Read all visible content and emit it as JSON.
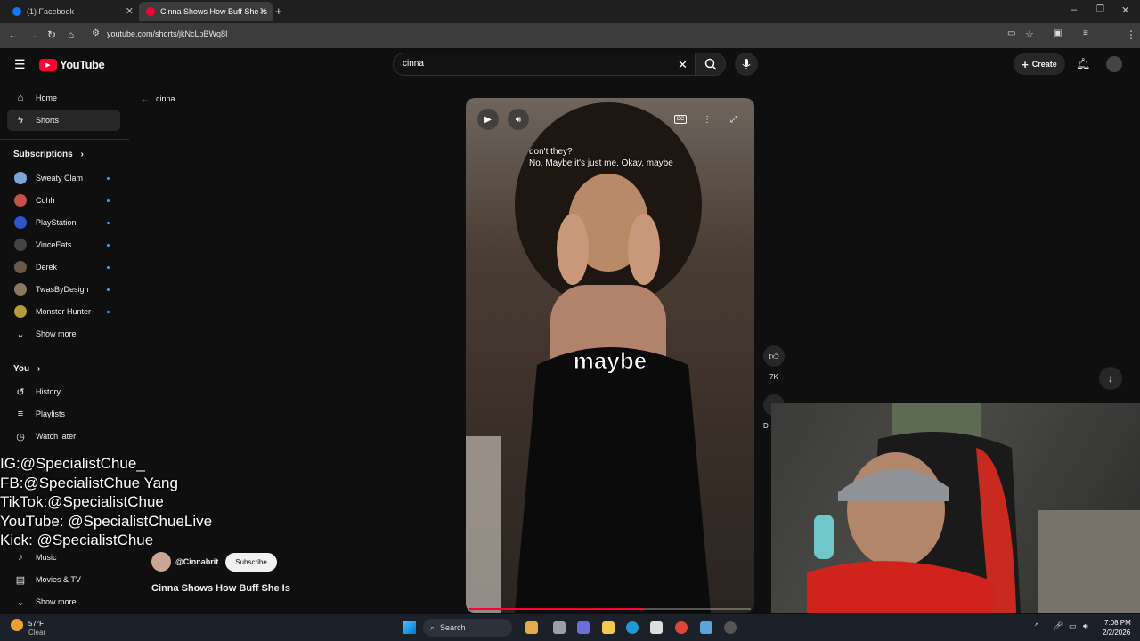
{
  "browser": {
    "tabs": [
      {
        "title": "(1) Facebook",
        "favicon_color": "#1877f2"
      },
      {
        "title": "Cinna Shows How Buff She Is -",
        "favicon_color": "#ff0033"
      }
    ],
    "url": "youtube.com/shorts/jkNcLpBWq8I"
  },
  "header": {
    "logo_text": "YouTube",
    "search_value": "cinna",
    "create_label": "Create"
  },
  "sidebar": {
    "main": [
      {
        "label": "Home",
        "icon": "home-icon"
      },
      {
        "label": "Shorts",
        "icon": "shorts-icon"
      }
    ],
    "subscriptions_title": "Subscriptions",
    "subscriptions": [
      {
        "label": "Sweaty Clam",
        "color": "#7aa7d6"
      },
      {
        "label": "Cohh",
        "color": "#c2544a"
      },
      {
        "label": "PlayStation",
        "color": "#2d55c8"
      },
      {
        "label": "VinceEats",
        "color": "#444444"
      },
      {
        "label": "Derek",
        "color": "#6b5a4a"
      },
      {
        "label": "TwasByDesign",
        "color": "#8a7a60"
      },
      {
        "label": "Monster Hunter",
        "color": "#b79a3a"
      }
    ],
    "show_more_1": "Show more",
    "you_title": "You",
    "you_items": [
      {
        "label": "History",
        "icon": "history-icon"
      },
      {
        "label": "Playlists",
        "icon": "playlists-icon"
      },
      {
        "label": "Watch later",
        "icon": "watch-later-icon"
      }
    ],
    "lower_items": [
      {
        "label": "Music",
        "icon": "music-icon"
      },
      {
        "label": "Movies & TV",
        "icon": "movies-icon"
      }
    ],
    "show_more_2": "Show more"
  },
  "shorts": {
    "back_label": "cinna",
    "caption_line1": "don't they?",
    "caption_line2": "No. Maybe it's just me. Okay, maybe",
    "big_word": "maybe",
    "channel": "@Cinnabrit",
    "subscribe_label": "Subscribe",
    "title": "Cinna Shows How Buff She Is",
    "like_count": "7K",
    "dislike_label": "Di",
    "progress": 0.62
  },
  "overlay": {
    "lines": [
      "IG:@SpecialistChue_",
      "FB:@SpecialistChue Yang",
      "TikTok:@SpecialistChue",
      "YouTube: @SpecialistChueLive",
      "Kick: @SpecialistChue"
    ]
  },
  "taskbar": {
    "weather_temp": "57°F",
    "weather_desc": "Clear",
    "search_label": "Search",
    "time": "7:08 PM",
    "date": "2/2/2026"
  }
}
